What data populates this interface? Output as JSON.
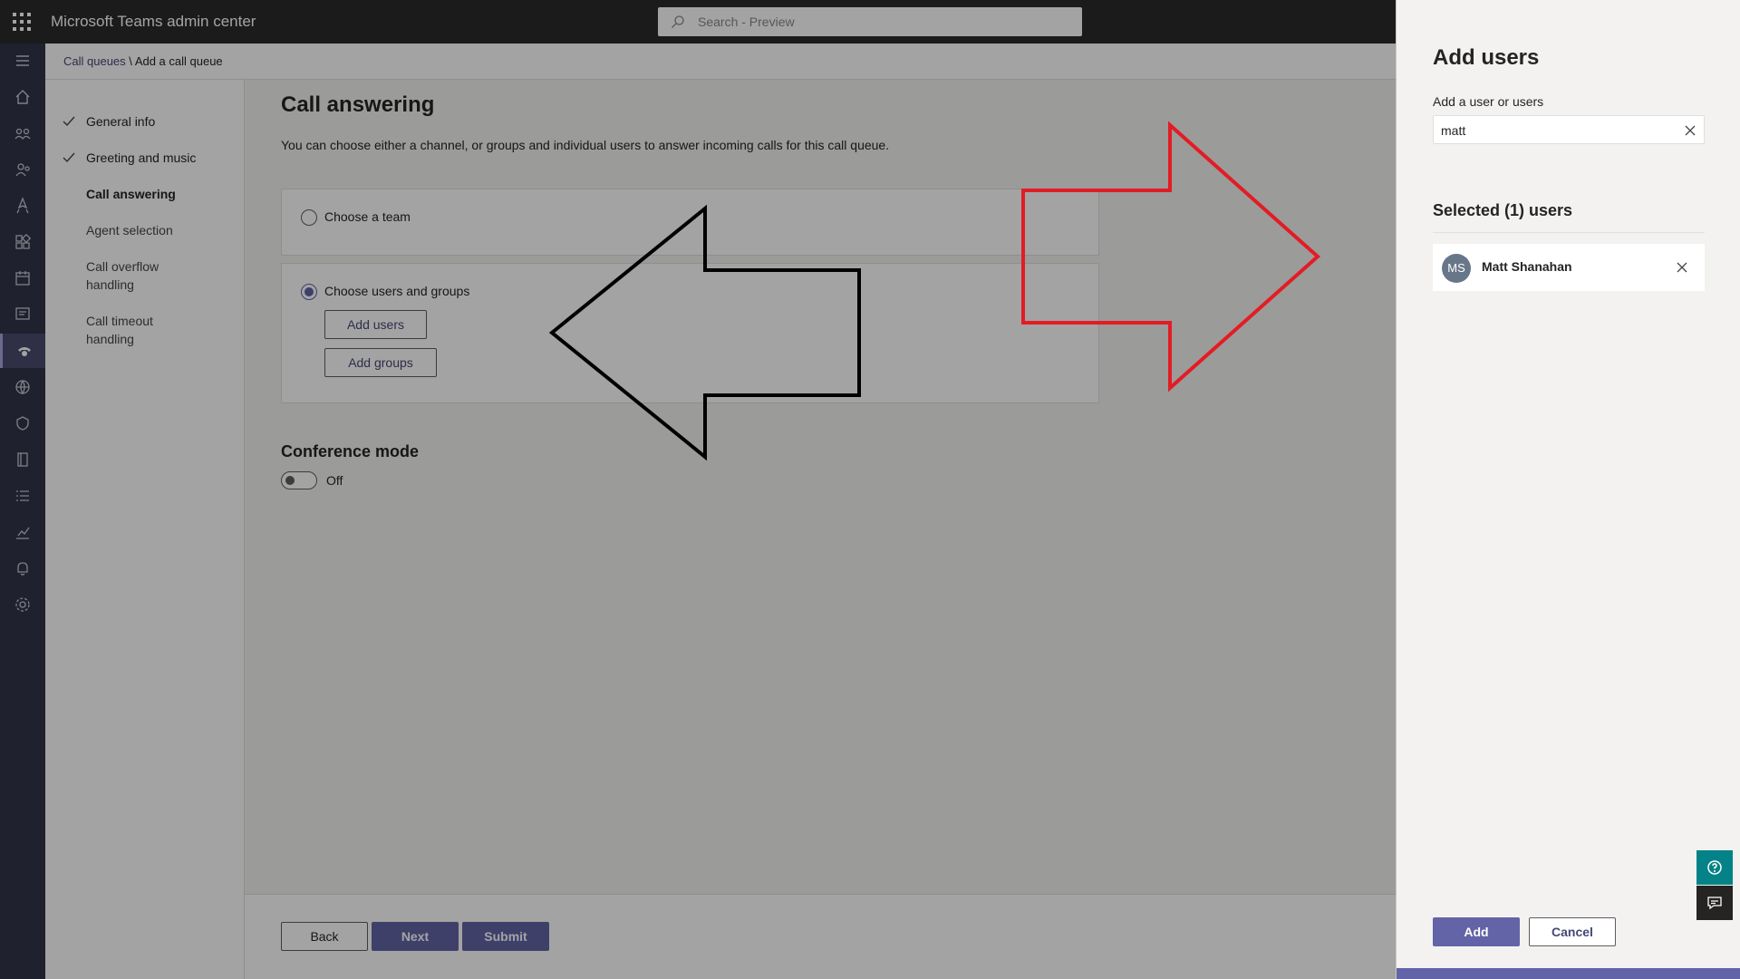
{
  "header": {
    "app_title": "Microsoft Teams admin center",
    "search_placeholder": "Search - Preview"
  },
  "rail": {
    "items": [
      "menu-icon",
      "home-icon",
      "teams-icon",
      "users-icon",
      "deployment-icon",
      "apps-icon",
      "meetings-icon",
      "messaging-icon",
      "voice-icon",
      "locations-icon",
      "policy-icon",
      "planning-icon",
      "analytics-icon",
      "reports-icon",
      "notifications-icon",
      "settings-icon"
    ],
    "active": "voice-icon"
  },
  "breadcrumb": {
    "parent": "Call queues",
    "separator": "\\",
    "current": "Add a call queue"
  },
  "steps": [
    {
      "label": "General info",
      "state": "done"
    },
    {
      "label": "Greeting and music",
      "state": "done"
    },
    {
      "label": "Call answering",
      "state": "current"
    },
    {
      "label": "Agent selection",
      "state": "pending"
    },
    {
      "label": "Call overflow handling",
      "state": "pending"
    },
    {
      "label": "Call timeout handling",
      "state": "pending"
    }
  ],
  "main": {
    "title": "Call answering",
    "description": "You can choose either a channel, or groups and individual users to answer incoming calls for this call queue.",
    "option_team": "Choose a team",
    "option_users_groups": "Choose users and groups",
    "add_users": "Add users",
    "add_groups": "Add groups",
    "conference_title": "Conference mode",
    "conference_state": "Off"
  },
  "footer": {
    "back": "Back",
    "next": "Next",
    "submit": "Submit"
  },
  "panel": {
    "title": "Add users",
    "field_label": "Add a user or users",
    "search_value": "matt",
    "selected_title": "Selected (1) users",
    "selected_users": [
      {
        "initials": "MS",
        "name": "Matt Shanahan"
      }
    ],
    "add": "Add",
    "cancel": "Cancel"
  },
  "colors": {
    "accent": "#6264a7",
    "rail": "#33344a",
    "topbar": "#2b2b2b",
    "annotation_black": "#000000",
    "annotation_red": "#e31c24"
  }
}
